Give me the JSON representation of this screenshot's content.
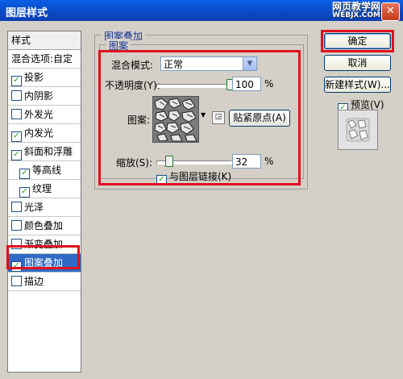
{
  "window": {
    "title": "图层样式",
    "close_glyph": "✕"
  },
  "watermark": {
    "line1": "网页教学网",
    "line2": "WEBJX.COM"
  },
  "styles_panel": {
    "header": "样式",
    "items": [
      {
        "label": "混合选项:自定",
        "checkbox": false,
        "checked": false,
        "indent": false,
        "selected": false
      },
      {
        "label": "投影",
        "checkbox": true,
        "checked": true,
        "indent": false,
        "selected": false
      },
      {
        "label": "内阴影",
        "checkbox": true,
        "checked": false,
        "indent": false,
        "selected": false
      },
      {
        "label": "外发光",
        "checkbox": true,
        "checked": false,
        "indent": false,
        "selected": false
      },
      {
        "label": "内发光",
        "checkbox": true,
        "checked": true,
        "indent": false,
        "selected": false
      },
      {
        "label": "斜面和浮雕",
        "checkbox": true,
        "checked": true,
        "indent": false,
        "selected": false
      },
      {
        "label": "等高线",
        "checkbox": true,
        "checked": true,
        "indent": true,
        "selected": false
      },
      {
        "label": "纹理",
        "checkbox": true,
        "checked": true,
        "indent": true,
        "selected": false
      },
      {
        "label": "光泽",
        "checkbox": true,
        "checked": false,
        "indent": false,
        "selected": false
      },
      {
        "label": "颜色叠加",
        "checkbox": true,
        "checked": false,
        "indent": false,
        "selected": false
      },
      {
        "label": "渐变叠加",
        "checkbox": true,
        "checked": false,
        "indent": false,
        "selected": false
      },
      {
        "label": "图案叠加",
        "checkbox": true,
        "checked": true,
        "indent": false,
        "selected": true
      },
      {
        "label": "描边",
        "checkbox": true,
        "checked": false,
        "indent": false,
        "selected": false
      }
    ]
  },
  "pattern_overlay": {
    "group_title": "图案叠加",
    "subgroup_title": "图案",
    "blend_mode_label": "混合模式:",
    "blend_mode_value": "正常",
    "opacity_label": "不透明度(Y):",
    "opacity_value": "100",
    "opacity_unit": "%",
    "opacity_fraction": 1.0,
    "pattern_label": "图案:",
    "snap_origin_label": "贴紧原点(A)",
    "scale_label": "缩放(S):",
    "scale_value": "32",
    "scale_unit": "%",
    "scale_fraction": 0.03,
    "link_label": "与图层链接(K)",
    "link_checked": true
  },
  "buttons": {
    "ok": "确定",
    "cancel": "取消",
    "new_style": "新建样式(W)...",
    "preview_label": "预览(V)",
    "preview_checked": true
  },
  "colors": {
    "highlight_red": "#e0101e",
    "selection_blue": "#316ac5",
    "titlebar_blue": "#0b49c4"
  }
}
